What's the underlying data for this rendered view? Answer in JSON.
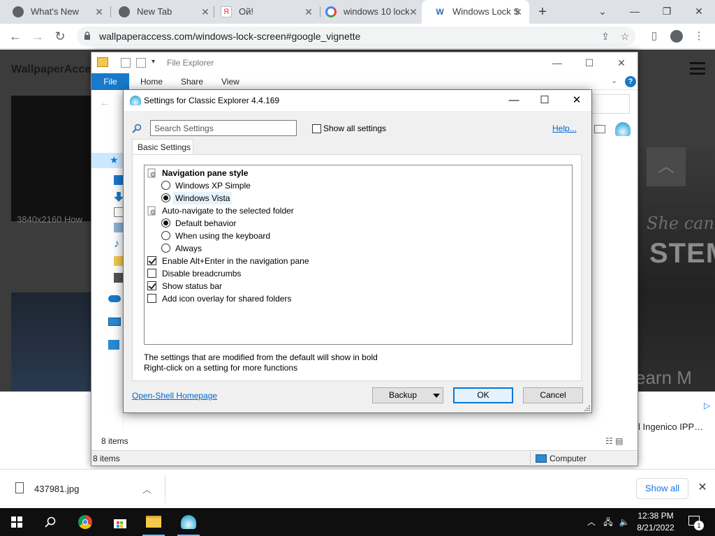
{
  "browser": {
    "tabs": [
      {
        "title": "What's New",
        "icon": "chrome-icon"
      },
      {
        "title": "New Tab",
        "icon": "chrome-icon"
      },
      {
        "title": "Ой!",
        "icon": "yandex-icon"
      },
      {
        "title": "windows 10 lock",
        "icon": "google-icon"
      },
      {
        "title": "Windows Lock S",
        "icon": "wallpaperaccess-icon",
        "active": true
      }
    ],
    "url": "wallpaperaccess.com/windows-lock-screen#google_vignette",
    "accent": "#1a73e8"
  },
  "webpage": {
    "brand": "WallpaperAcce",
    "resolution_text": "3840x2160 How",
    "right_text_1": "She can",
    "right_text_2": "STEM",
    "right_text_3": "earn M",
    "ad_text": "l Ingenico IPP…"
  },
  "file_explorer": {
    "title": "File Explorer",
    "ribbon_tabs": [
      "File",
      "Home",
      "Share",
      "View"
    ],
    "items_count": "8 items",
    "status_items": "8 items",
    "status_location": "Computer",
    "accent": "#1979ca"
  },
  "dialog": {
    "title": "Settings for Classic Explorer 4.4.169",
    "search_placeholder": "Search Settings",
    "show_all_label": "Show all settings",
    "help_link": "Help...",
    "tab_label": "Basic Settings",
    "settings": [
      {
        "text": "Navigation pane style",
        "kind": "group",
        "bold": true
      },
      {
        "text": "Windows XP Simple",
        "kind": "radio",
        "checked": false
      },
      {
        "text": "Windows Vista",
        "kind": "radio",
        "checked": true,
        "highlight": true
      },
      {
        "text": "Auto-navigate to the selected folder",
        "kind": "group",
        "bold": false
      },
      {
        "text": "Default behavior",
        "kind": "radio",
        "checked": true
      },
      {
        "text": "When using the keyboard",
        "kind": "radio",
        "checked": false
      },
      {
        "text": "Always",
        "kind": "radio",
        "checked": false
      },
      {
        "text": "Enable Alt+Enter in the navigation pane",
        "kind": "checkbox",
        "checked": true
      },
      {
        "text": "Disable breadcrumbs",
        "kind": "checkbox",
        "checked": false
      },
      {
        "text": "Show status bar",
        "kind": "checkbox",
        "checked": true
      },
      {
        "text": "Add icon overlay for shared folders",
        "kind": "checkbox",
        "checked": false
      }
    ],
    "info_line_1": "The settings that are modified from the default will show in bold",
    "info_line_2": "Right-click on a setting for more functions",
    "homepage_link": "Open-Shell Homepage",
    "backup_label": "Backup",
    "ok_label": "OK",
    "cancel_label": "Cancel"
  },
  "downloads": {
    "file_name": "437981.jpg",
    "show_all": "Show all"
  },
  "taskbar": {
    "time": "12:38 PM",
    "date": "8/21/2022",
    "notification_count": "1"
  }
}
